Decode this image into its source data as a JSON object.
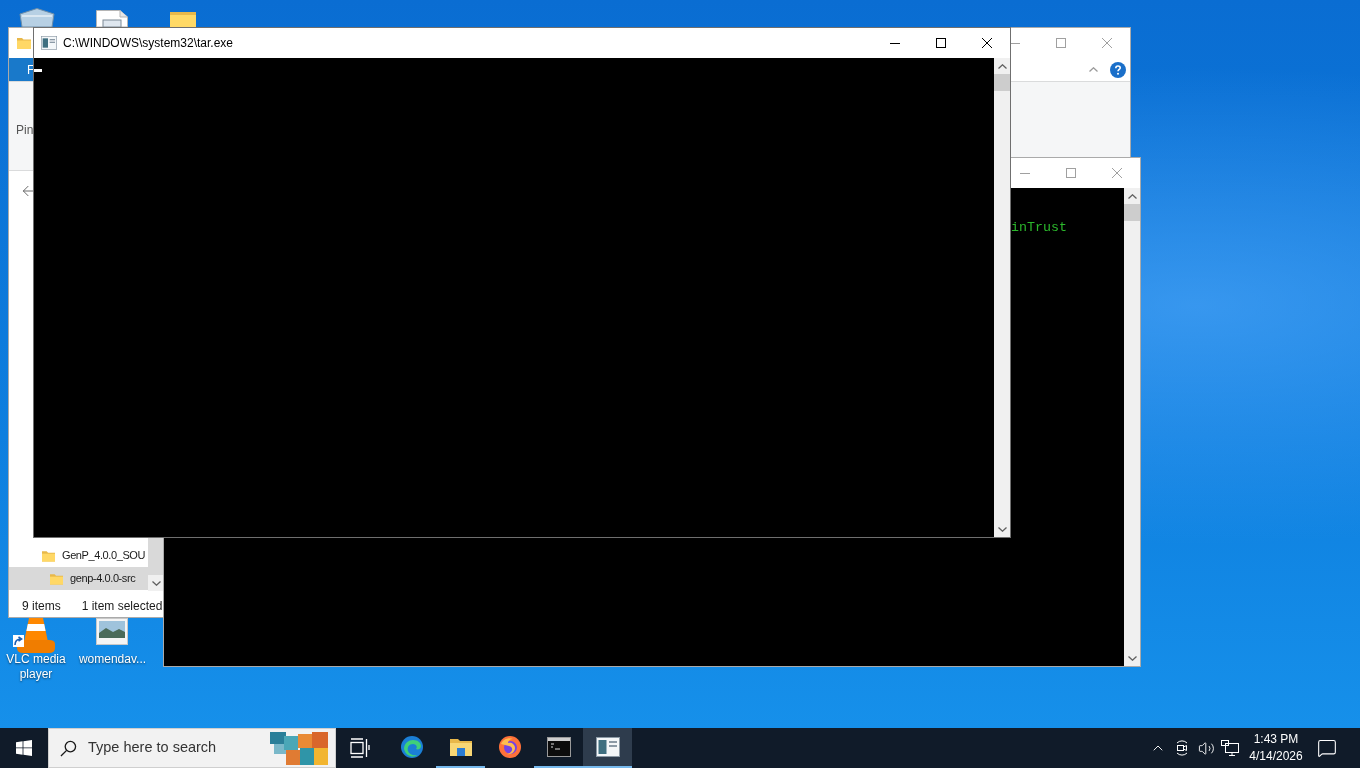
{
  "desktop": {
    "icons": [
      {
        "kind": "vlc",
        "label": "VLC media player",
        "shortcut": true
      },
      {
        "kind": "image",
        "label": "womendav...",
        "shortcut": false
      }
    ]
  },
  "explorer": {
    "active": false,
    "ribbon": {
      "tab": "F",
      "group_label": "Pin"
    },
    "tree": [
      {
        "label": "GenP_4.0.0_SOU",
        "selected": false,
        "children": [
          {
            "label": "genp-4.0.0-src",
            "selected": true
          }
        ]
      }
    ],
    "status_bar": {
      "items": "9 items",
      "selection": "1 item selected"
    }
  },
  "console": {
    "active": false,
    "lines": [
      "inTrust"
    ]
  },
  "tar_window": {
    "active": true,
    "title": "C:\\WINDOWS\\system32\\tar.exe",
    "cursor": true
  },
  "taskbar": {
    "search_placeholder": "Type here to search",
    "apps": [
      {
        "kind": "edge",
        "running": false,
        "selected": false
      },
      {
        "kind": "folder",
        "running": true,
        "selected": false
      },
      {
        "kind": "firefox",
        "running": false,
        "selected": false
      },
      {
        "kind": "terminal",
        "running": true,
        "selected": false
      },
      {
        "kind": "app-window",
        "running": true,
        "selected": true
      }
    ],
    "clock": {
      "time": "1:43 PM",
      "date": "4/14/2026"
    }
  }
}
